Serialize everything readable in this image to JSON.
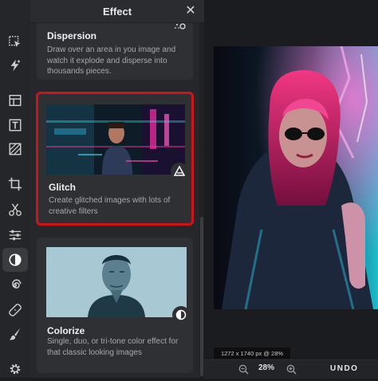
{
  "panel": {
    "title": "Effect",
    "close_label": "✕"
  },
  "effects": [
    {
      "name": "Dispersion",
      "description": "Draw over an area in you image and watch it explode and disperse into thousands pieces."
    },
    {
      "name": "Glitch",
      "description": "Create glitched images with lots of creative filters",
      "selected": true
    },
    {
      "name": "Colorize",
      "description": "Single, duo, or tri-tone color effect for that classic looking images"
    }
  ],
  "toolbar": {
    "icons": [
      "select-icon",
      "quick-effects-icon",
      "layout-icon",
      "text-icon",
      "texture-icon",
      "crop-icon",
      "cutout-icon",
      "adjust-icon",
      "effect-icon",
      "swirl-icon",
      "heal-icon",
      "brush-icon",
      "settings-icon"
    ],
    "active": "effect-icon"
  },
  "canvas": {
    "status": "1272 x 1740 px @ 28%",
    "zoom": "28%",
    "undo_label": "UNDO"
  },
  "colors": {
    "selection_border": "#d0131b",
    "panel_bg": "#26272a",
    "card_bg": "#2f3034"
  }
}
